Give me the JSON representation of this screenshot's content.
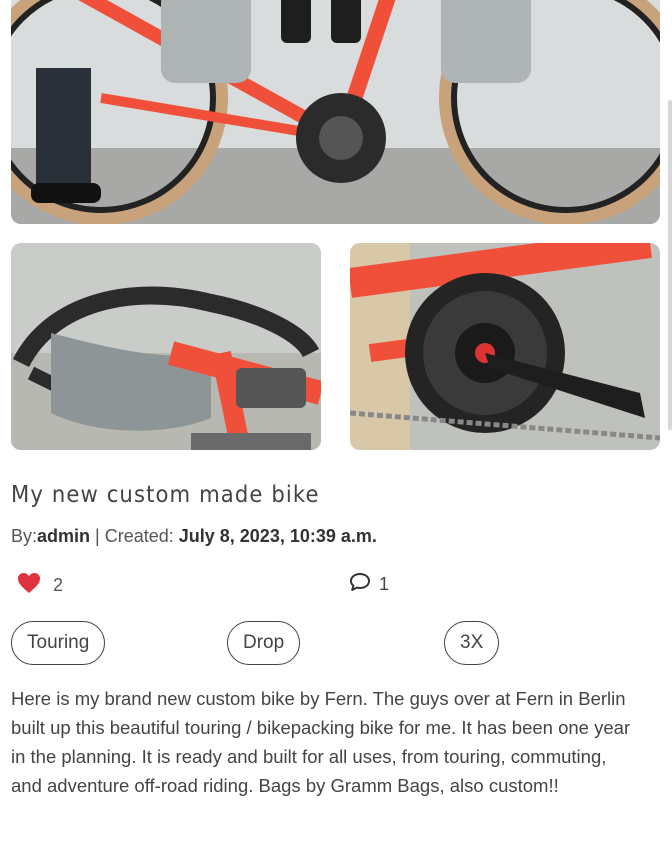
{
  "post": {
    "title": "My new custom made bike",
    "by_label": "By:",
    "author": "admin",
    "separator": " | Created: ",
    "created": "July 8, 2023, 10:39 a.m.",
    "likes": "2",
    "comments": "1",
    "tags": [
      "Touring",
      "Drop",
      "3X"
    ],
    "body": "Here is my brand new custom bike by Fern. The guys over at Fern in Berlin built up this beautiful touring / bikepacking bike for me. It has been one year in the planning. It is ready and built for all uses, from touring, commuting, and adventure off-road riding. Bags by Gramm Bags, also custom!!"
  },
  "icons": {
    "like": "heart-icon",
    "comment": "comment-icon"
  },
  "colors": {
    "heart": "#e0323e",
    "bike_frame": "#f0503a",
    "text": "#444444"
  }
}
